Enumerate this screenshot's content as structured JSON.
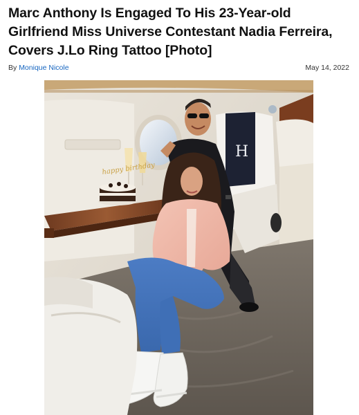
{
  "article": {
    "headline": "Marc Anthony Is Engaged To His 23-Year-old Girlfriend Miss Universe Contestant Nadia Ferreira, Covers J.Lo Ring Tattoo [Photo]",
    "by_prefix": "By",
    "author": "Monique Nicole",
    "date": "May 14, 2022"
  },
  "photo": {
    "cake_topper": "happy birthday",
    "seat_letter": "H"
  },
  "colors": {
    "link": "#1565c0",
    "headline": "#111111"
  }
}
